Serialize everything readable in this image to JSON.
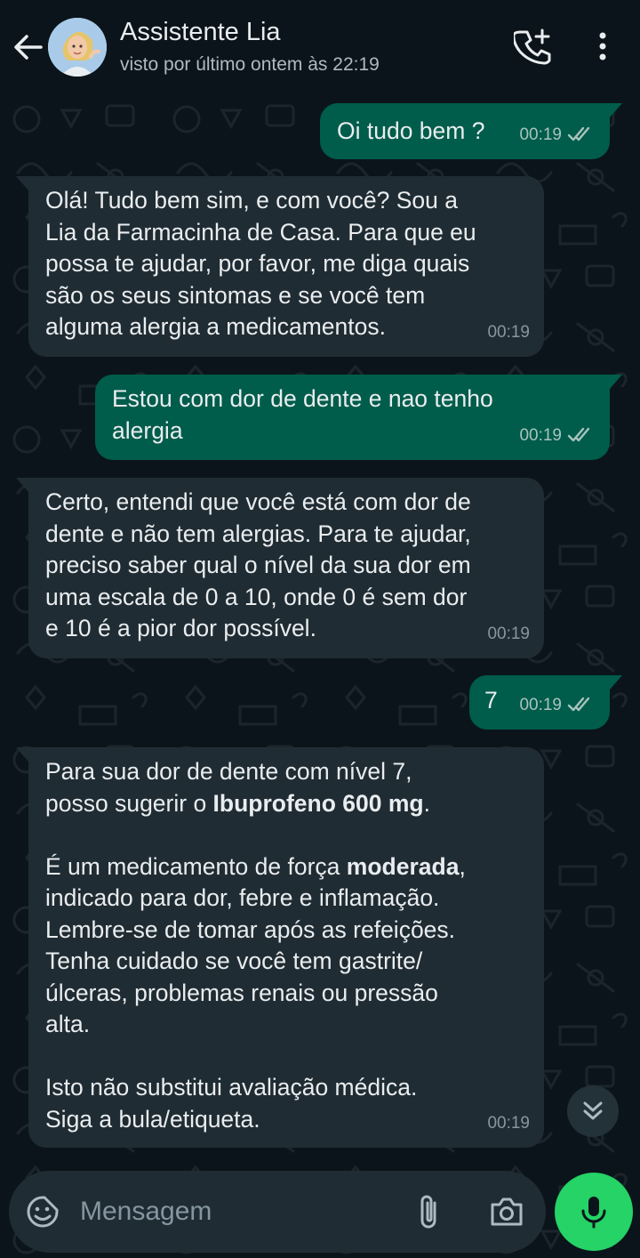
{
  "header": {
    "contact_name": "Assistente Lia",
    "status": "visto por último ontem às 22:19"
  },
  "icons": {
    "back": "arrow-left",
    "call": "phone-plus",
    "more": "vertical-dots",
    "scroll_down": "double-chevron-down",
    "emoji": "smiley",
    "attach": "paperclip",
    "camera": "camera",
    "mic": "microphone",
    "read_receipt": "double-check"
  },
  "messages": [
    {
      "from": "me",
      "text": "Oi tudo bem ?",
      "time": "00:19"
    },
    {
      "from": "assistant",
      "text": "Olá! Tudo bem sim, e com você? Sou a\nLia da Farmacinha de Casa. Para que eu\npossa te ajudar, por favor, me diga quais\nsão os seus sintomas e se você tem\nalguma alergia a medicamentos.",
      "time": "00:19"
    },
    {
      "from": "me",
      "text": "Estou com dor de dente e nao tenho\nalergia",
      "time": "00:19"
    },
    {
      "from": "assistant",
      "text": "Certo, entendi que você está com dor de\ndente e não tem alergias. Para te ajudar,\npreciso saber qual o nível da sua dor em\numa escala de 0 a 10, onde 0 é sem dor\ne 10 é a pior dor possível.",
      "time": "00:19"
    },
    {
      "from": "me",
      "text": "7",
      "time": "00:19"
    },
    {
      "from": "assistant",
      "time": "00:19",
      "parts": {
        "p1_pre": "Para sua dor de dente com nível 7,\nposso sugerir o ",
        "p1_bold": "Ibuprofeno 600 mg",
        "p1_post": ".",
        "p2_pre": "É um medicamento de força ",
        "p2_bold": "moderada",
        "p2_post": ",\nindicado para dor, febre e inflamação.\nLembre-se de tomar após as refeições.\nTenha cuidado se você tem gastrite/\núlceras, problemas renais ou pressão\nalta.",
        "p3": "Isto não substitui avaliação médica.\nSiga a bula/etiqueta."
      }
    }
  ],
  "composer": {
    "placeholder": "Mensagem"
  },
  "colors": {
    "background": "#0b141a",
    "incoming_bubble": "#202c33",
    "outgoing_bubble": "#005c4b",
    "accent_green": "#25d366"
  }
}
